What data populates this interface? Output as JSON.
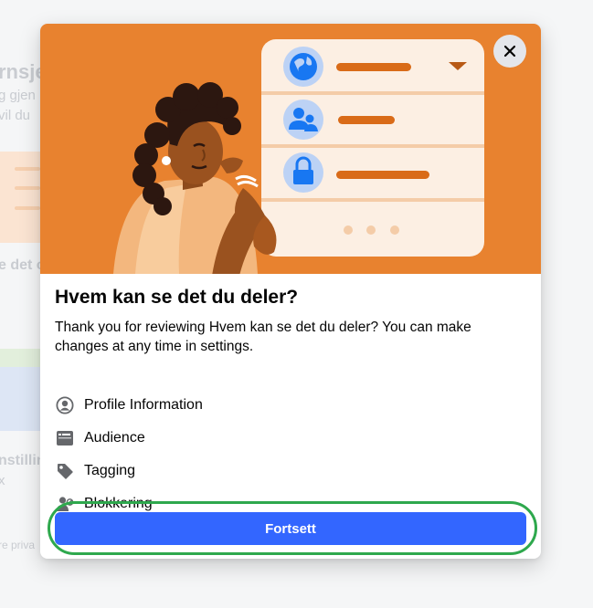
{
  "background": {
    "fragments": [
      "rnsje",
      "g gjen",
      "vil du",
      "e det o",
      "nstillin",
      "x",
      "re priva"
    ]
  },
  "modal": {
    "close_icon": "close-icon",
    "title": "Hvem kan se det du deler?",
    "description": "Thank you for reviewing Hvem kan se det du deler? You can make changes at any time in settings.",
    "items": [
      {
        "label": "Profile Information",
        "icon": "profile-circle-icon"
      },
      {
        "label": "Audience",
        "icon": "audience-card-icon"
      },
      {
        "label": "Tagging",
        "icon": "tag-icon"
      },
      {
        "label": "Blokkering",
        "icon": "block-person-icon"
      }
    ],
    "continue_label": "Fortsett"
  },
  "colors": {
    "hero_orange": "#e8822f",
    "primary_button": "#3366ff",
    "highlight_outline": "#2ea84d"
  }
}
